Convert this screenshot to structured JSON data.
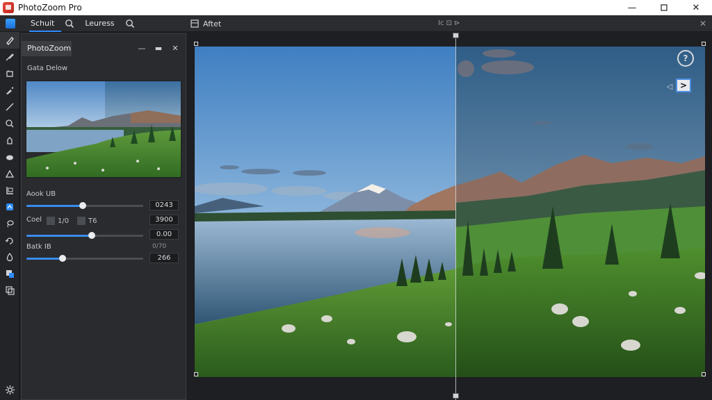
{
  "window": {
    "title": "PhotoZoom Pro",
    "controls": {
      "minimize": "—",
      "maximize": "⚙",
      "close": "✕"
    }
  },
  "toolbar": {
    "tabs": [
      "Schuit",
      "Leuress"
    ],
    "after_label": "Aftet",
    "center_label": "Ic ⊡ ⊳",
    "close_glyph": "✕"
  },
  "tools": [
    "pen-icon",
    "brush-icon",
    "crop-icon",
    "dropper-icon",
    "line-icon",
    "search-icon",
    "stamp-icon",
    "cloud-icon",
    "triangle-icon",
    "frame-icon",
    "blue-square-icon",
    "lasso-icon",
    "rotate-icon",
    "drop-icon",
    "layers-icon",
    "copy-icon"
  ],
  "panel": {
    "tab_label": "PhotoZoom",
    "subtitle": "Gata Delow",
    "controls": {
      "minimize": "—",
      "pin": "▬",
      "close": "✕"
    },
    "sliders": [
      {
        "label": "Aook UB",
        "value_text": "0243",
        "level": 0.48
      },
      {
        "label": "Coel",
        "chip1": "1/0",
        "chip2": "T6",
        "value_text": "3900"
      },
      {
        "label": "",
        "value_text": "0.00",
        "level": 0.56
      },
      {
        "label": "Batk IB",
        "small_value": "0/70",
        "value_text": "266",
        "level": 0.31
      }
    ]
  },
  "viewer": {
    "info_glyph": "?",
    "prev_glyph": "◁",
    "next_glyph": ">",
    "split_position": 0.525
  },
  "colors": {
    "accent": "#2f8cff",
    "panel_bg": "#2a2b2e",
    "canvas_bg": "#1e1f22"
  }
}
